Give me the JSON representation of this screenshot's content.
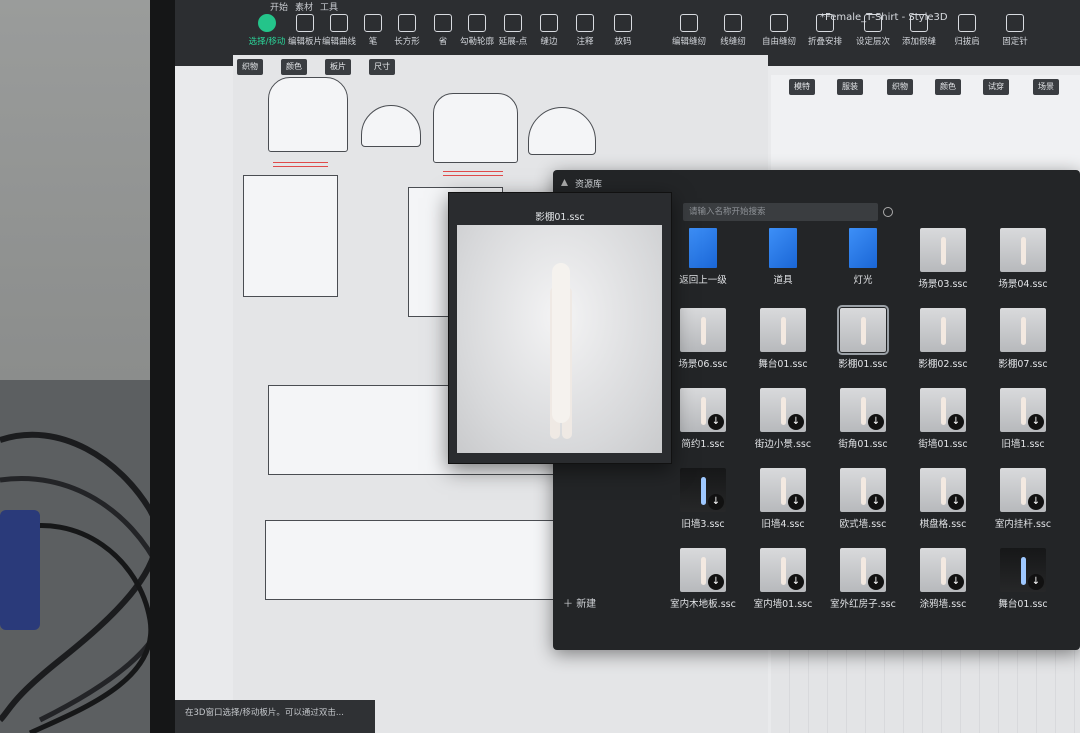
{
  "window": {
    "title": "*Female_T-Shirt - Style3D"
  },
  "menu": {
    "tabs": [
      "开始",
      "素材",
      "工具"
    ],
    "active": "开始"
  },
  "toolbar": {
    "tools": [
      {
        "label": "选择/移动",
        "icon": "select-move-icon",
        "active": true
      },
      {
        "label": "编辑板片",
        "icon": "edit-pattern-icon"
      },
      {
        "label": "编辑曲线",
        "icon": "edit-curve-icon"
      },
      {
        "label": "笔",
        "icon": "pen-icon"
      },
      {
        "label": "长方形",
        "icon": "rectangle-icon"
      },
      {
        "label": "省",
        "icon": "dart-icon"
      },
      {
        "label": "勾勒轮廓",
        "icon": "trace-outline-icon"
      },
      {
        "label": "延展-点",
        "icon": "extend-point-icon"
      },
      {
        "label": "缝边",
        "icon": "seam-allowance-icon"
      },
      {
        "label": "注释",
        "icon": "annotation-icon"
      },
      {
        "label": "放码",
        "icon": "grading-icon"
      },
      {
        "label": "编辑缝纫",
        "icon": "edit-sewing-icon"
      },
      {
        "label": "线缝纫",
        "icon": "segment-sewing-icon"
      },
      {
        "label": "自由缝纫",
        "icon": "free-sewing-icon"
      },
      {
        "label": "折叠安排",
        "icon": "fold-arrange-icon"
      },
      {
        "label": "设定层次",
        "icon": "set-layer-icon"
      },
      {
        "label": "添加假缝",
        "icon": "add-tack-icon"
      },
      {
        "label": "归拔肩",
        "icon": "shrink-shoulder-icon"
      },
      {
        "label": "固定针",
        "icon": "pin-icon"
      }
    ]
  },
  "pane2d": {
    "tabs": [
      "织物",
      "颜色",
      "板片",
      "尺寸"
    ]
  },
  "pane3d": {
    "tabs": [
      "模特",
      "服装",
      "织物",
      "颜色",
      "试穿",
      "场景"
    ]
  },
  "library": {
    "title": "资源库",
    "search_placeholder": "请输入名称开始搜索",
    "new_label": "新建",
    "items": [
      {
        "label": "返回上一级",
        "kind": "folder"
      },
      {
        "label": "道具",
        "kind": "folder"
      },
      {
        "label": "灯光",
        "kind": "folder"
      },
      {
        "label": "场景03.ssc",
        "kind": "scene"
      },
      {
        "label": "场景04.ssc",
        "kind": "scene"
      },
      {
        "label": "场景06.ssc",
        "kind": "scene"
      },
      {
        "label": "舞台01.ssc",
        "kind": "scene"
      },
      {
        "label": "影棚01.ssc",
        "kind": "scene",
        "selected": true
      },
      {
        "label": "影棚02.ssc",
        "kind": "scene"
      },
      {
        "label": "影棚07.ssc",
        "kind": "scene"
      },
      {
        "label": "简约1.ssc",
        "kind": "download"
      },
      {
        "label": "街边小景.ssc",
        "kind": "download"
      },
      {
        "label": "街角01.ssc",
        "kind": "download"
      },
      {
        "label": "街墙01.ssc",
        "kind": "download"
      },
      {
        "label": "旧墙1.ssc",
        "kind": "download"
      },
      {
        "label": "旧墙3.ssc",
        "kind": "download-dark"
      },
      {
        "label": "旧墙4.ssc",
        "kind": "download"
      },
      {
        "label": "欧式墙.ssc",
        "kind": "download"
      },
      {
        "label": "棋盘格.ssc",
        "kind": "download"
      },
      {
        "label": "室内挂杆.ssc",
        "kind": "download"
      },
      {
        "label": "室内木地板.ssc",
        "kind": "download"
      },
      {
        "label": "室内墙01.ssc",
        "kind": "download"
      },
      {
        "label": "室外红房子.ssc",
        "kind": "download"
      },
      {
        "label": "涂鸦墙.ssc",
        "kind": "download"
      },
      {
        "label": "舞台01.ssc",
        "kind": "download-dark"
      }
    ]
  },
  "preview": {
    "title": "影棚01.ssc"
  },
  "status": {
    "text": "在3D窗口选择/移动板片。可以通过双击..."
  },
  "colors": {
    "accent": "#24c48a",
    "toolbar_bg": "#2c2e31",
    "library_bg": "#232527"
  }
}
